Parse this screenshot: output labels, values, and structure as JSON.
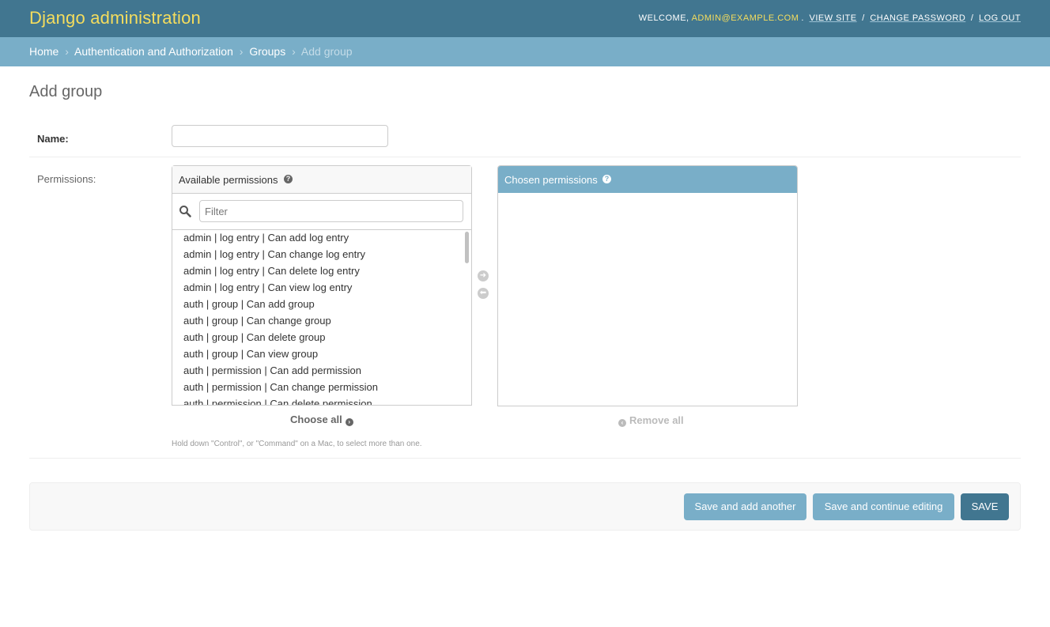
{
  "header": {
    "site_name": "Django administration",
    "welcome": "WELCOME,",
    "user": "ADMIN@EXAMPLE.COM",
    "view_site": "VIEW SITE",
    "change_password": "CHANGE PASSWORD",
    "log_out": "LOG OUT"
  },
  "breadcrumbs": {
    "home": "Home",
    "app": "Authentication and Authorization",
    "model": "Groups",
    "current": "Add group",
    "separator": "›"
  },
  "page": {
    "title": "Add group"
  },
  "form": {
    "name_label": "Name:",
    "name_value": "",
    "permissions_label": "Permissions:",
    "available_title": "Available permissions",
    "chosen_title": "Chosen permissions",
    "filter_placeholder": "Filter",
    "available_options": [
      "admin | log entry | Can add log entry",
      "admin | log entry | Can change log entry",
      "admin | log entry | Can delete log entry",
      "admin | log entry | Can view log entry",
      "auth | group | Can add group",
      "auth | group | Can change group",
      "auth | group | Can delete group",
      "auth | group | Can view group",
      "auth | permission | Can add permission",
      "auth | permission | Can change permission",
      "auth | permission | Can delete permission"
    ],
    "chosen_options": [],
    "choose_all": "Choose all",
    "remove_all": "Remove all",
    "help_text": "Hold down \"Control\", or \"Command\" on a Mac, to select more than one."
  },
  "actions": {
    "save_add_another": "Save and add another",
    "save_continue": "Save and continue editing",
    "save": "SAVE"
  },
  "colors": {
    "header_bg": "#417690",
    "breadcrumb_bg": "#79aec8",
    "site_name": "#f5dd5d",
    "primary_button": "#417690",
    "secondary_button": "#79aec8"
  }
}
